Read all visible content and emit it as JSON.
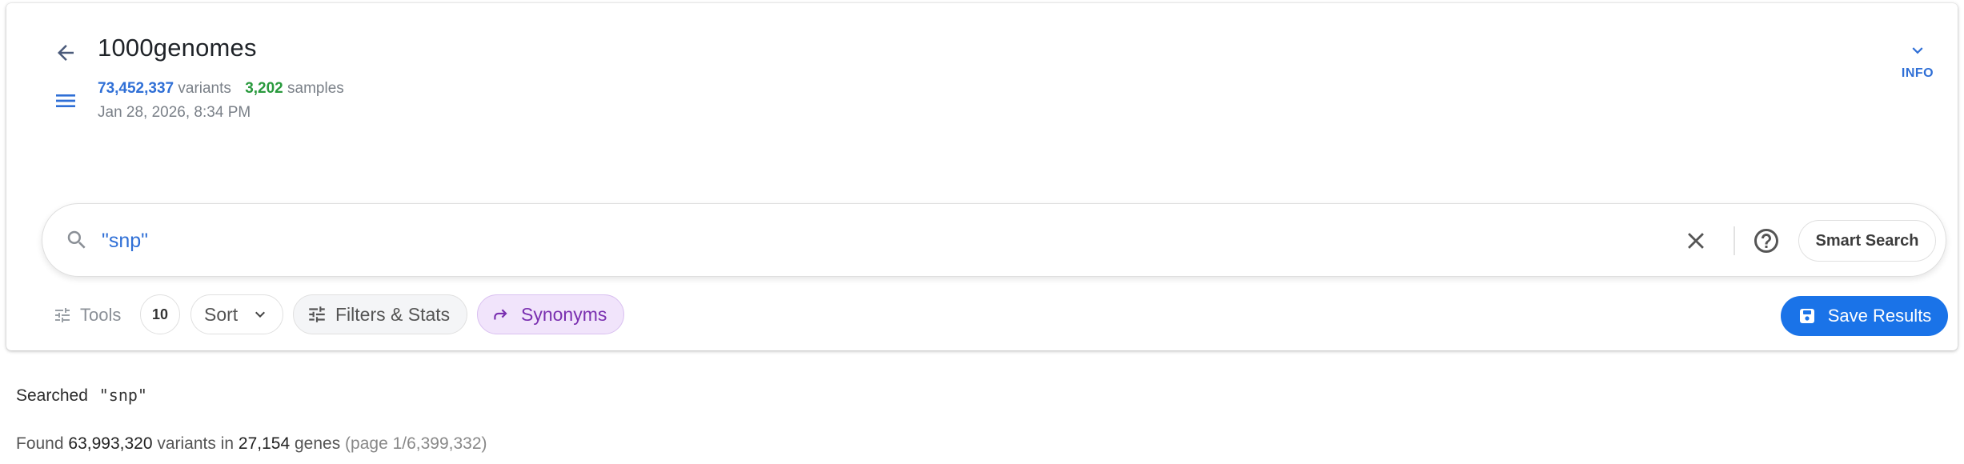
{
  "header": {
    "title": "1000genomes",
    "variants_count": "73,452,337",
    "variants_label": "variants",
    "samples_count": "3,202",
    "samples_label": "samples",
    "date": "Jan 28, 2026, 8:34 PM",
    "info_label": "INFO"
  },
  "search": {
    "value": "\"snp\"",
    "smart_search_label": "Smart Search"
  },
  "toolbar": {
    "tools_label": "Tools",
    "count": "10",
    "sort_label": "Sort",
    "filters_label": "Filters & Stats",
    "synonyms_label": "Synonyms",
    "save_label": "Save Results"
  },
  "results": {
    "searched_label": "Searched",
    "searched_term": "\"snp\"",
    "found_label": "Found",
    "variants_count": "63,993,320",
    "variants_in_label": "variants in",
    "genes_count": "27,154",
    "genes_label": "genes",
    "page_info": "(page 1/6,399,332)"
  },
  "colors": {
    "accent": "#1a73e8",
    "variants_blue": "#2f6fd6",
    "samples_green": "#2a9a3e",
    "synonyms_purple": "#7a2fb0"
  },
  "icons": [
    "arrow-back-icon",
    "menu-icon",
    "chevron-down-icon",
    "search-icon",
    "close-icon",
    "help-icon",
    "tune-icon",
    "chevron-down-icon",
    "tune-icon",
    "redo-arrow-icon",
    "save-icon"
  ]
}
